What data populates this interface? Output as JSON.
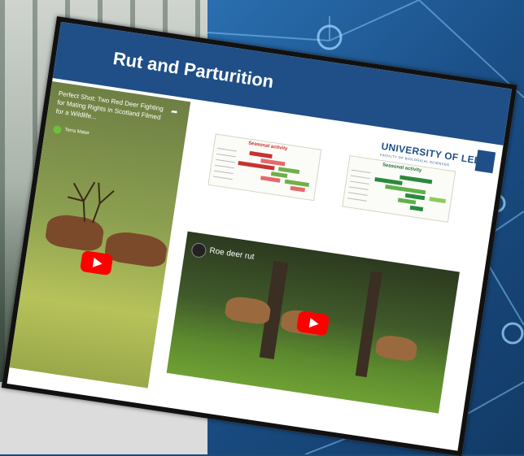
{
  "slide": {
    "title": "Rut and Parturition",
    "university": "UNIVERSITY OF LEEDS",
    "faculty": "FACULTY OF BIOLOGICAL SCIENCES"
  },
  "video1": {
    "title": "Perfect Shot: Two Red Deer Fighting for Mating Rights in Scotland Filmed for a Wildlife...",
    "channel": "Terra Mater"
  },
  "video2": {
    "title": "Roe deer rut"
  },
  "chart1": {
    "title": "Seasonal activity",
    "color": "#c83232",
    "accent": "#6fb04a"
  },
  "chart2": {
    "title": "Seasonal activity",
    "color": "#2a8a3e",
    "accent": "#6fb04a"
  },
  "colors": {
    "header": "#1f4f86",
    "youtube": "#ff0000"
  }
}
